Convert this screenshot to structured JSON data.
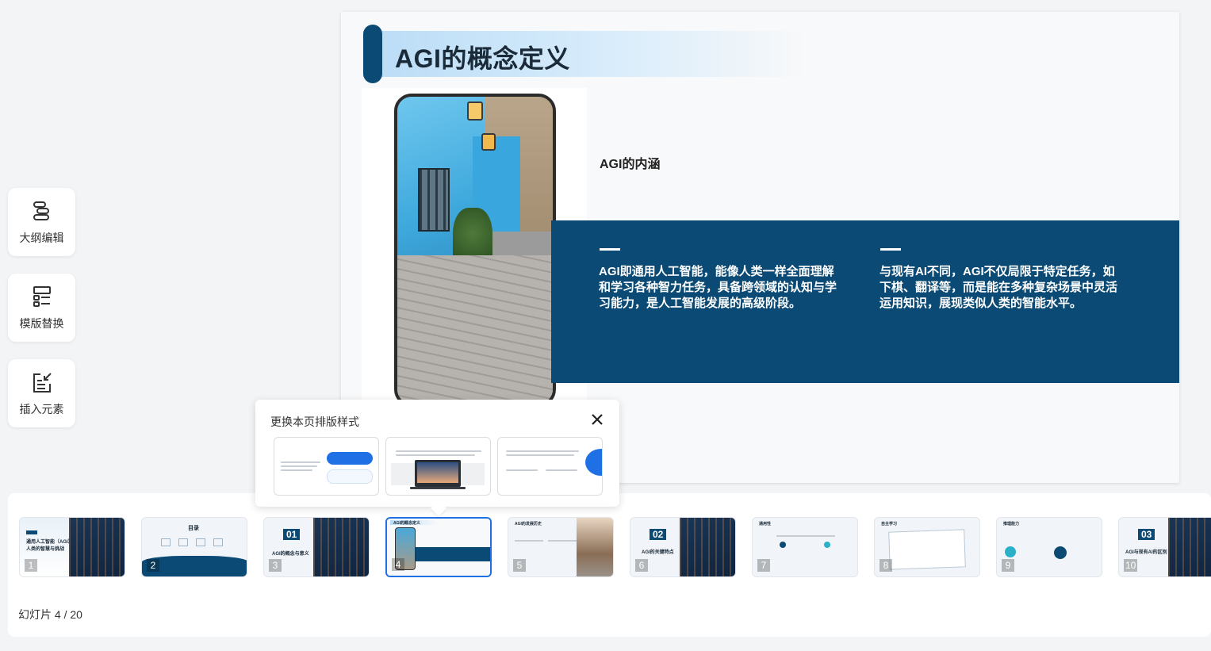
{
  "tools": [
    {
      "label": "大纲编辑",
      "icon": "outline-icon"
    },
    {
      "label": "模版替换",
      "icon": "template-icon"
    },
    {
      "label": "插入元素",
      "icon": "insert-icon"
    }
  ],
  "slide": {
    "title": "AGI的概念定义",
    "sub_heading": "AGI的内涵",
    "para_left": "AGI即通用人工智能，能像人类一样全面理解和学习各种智力任务，具备跨领域的认知与学习能力，是人工智能发展的高级阶段。",
    "para_right": "与现有AI不同，AGI不仅局限于特定任务，如下棋、翻译等，而是能在多种复杂场景中灵活运用知识，展现类似人类的智能水平。"
  },
  "popup": {
    "title": "更换本页排版样式",
    "close_icon": "close-icon"
  },
  "thumbnails": [
    {
      "num": "1",
      "title": "通用人工智能（AGI）：人类的智慧与挑战"
    },
    {
      "num": "2",
      "title": "目录"
    },
    {
      "num": "3",
      "title": "AGI的概念与意义",
      "badge": "01"
    },
    {
      "num": "4",
      "title": "AGI的概念定义"
    },
    {
      "num": "5",
      "title": "AGI的发展历史"
    },
    {
      "num": "6",
      "title": "AGI的关键特点",
      "badge": "02"
    },
    {
      "num": "7",
      "title": "通用性"
    },
    {
      "num": "8",
      "title": "自主学习"
    },
    {
      "num": "9",
      "title": "推理能力"
    },
    {
      "num": "10",
      "title": "AGI与现有AI的区别",
      "badge": "03"
    }
  ],
  "footer": {
    "label": "幻灯片  4 / 20"
  },
  "colors": {
    "accent_dark": "#0b4a74",
    "selection": "#1f6fe5"
  }
}
